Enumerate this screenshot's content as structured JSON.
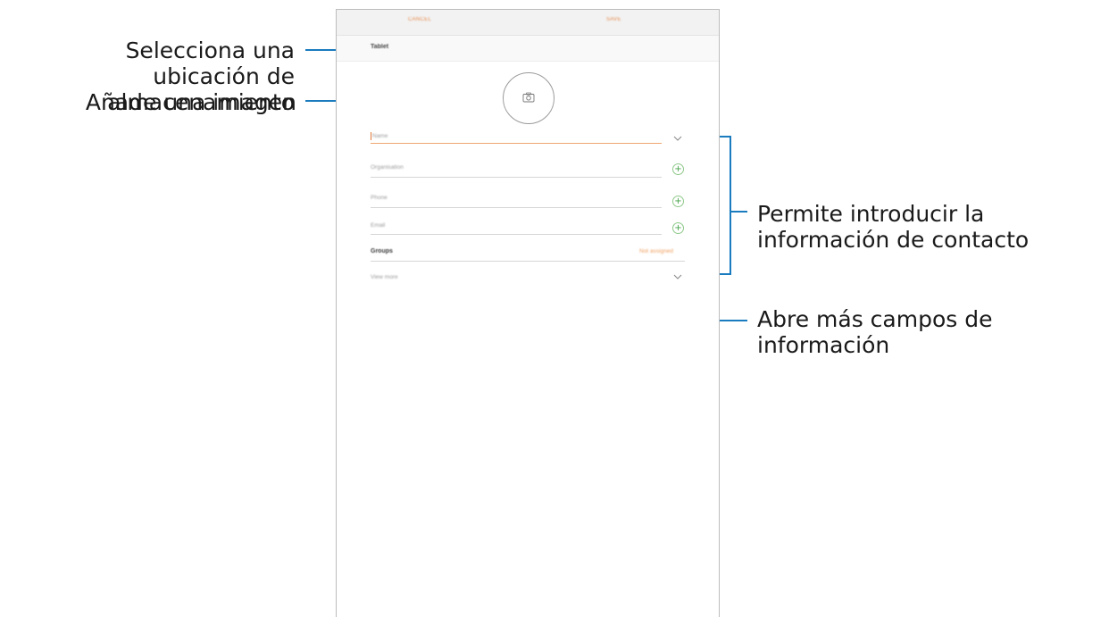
{
  "callouts": {
    "storage": "Selecciona una ubicación de almacenamiento",
    "image": "Añade una imagen",
    "contact_info": "Permite introducir la información de contacto",
    "more_fields": "Abre más campos de información"
  },
  "screen": {
    "cancel_label": "CANCEL",
    "save_label": "SAVE",
    "storage_location": "Tablet",
    "fields": {
      "name_placeholder": "Name",
      "organisation_placeholder": "Organisation",
      "phone_placeholder": "Phone",
      "email_placeholder": "Email"
    },
    "groups": {
      "label": "Groups",
      "value": "Not assigned"
    },
    "view_more_label": "View more"
  },
  "colors": {
    "callout_line": "#1a7bbf",
    "accent": "#e88a4a",
    "add_icon": "#43a047"
  },
  "icons": [
    "camera-icon",
    "chevron-down-icon",
    "plus-icon"
  ]
}
